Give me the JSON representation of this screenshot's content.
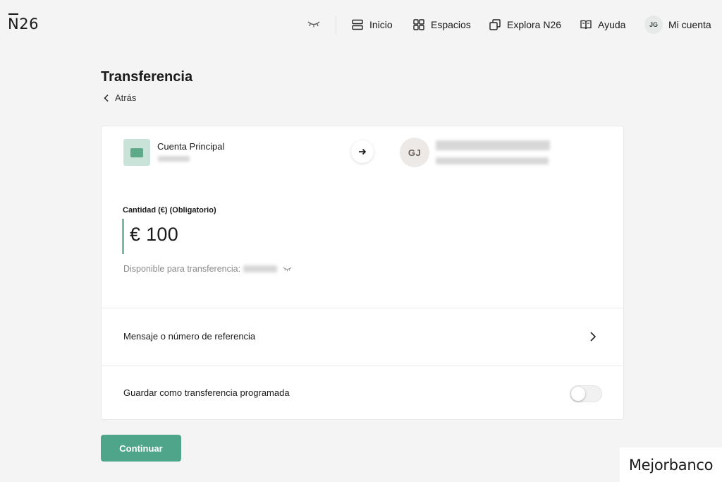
{
  "nav": {
    "logo_n": "N",
    "logo_rest": "26",
    "items": [
      {
        "label": "Inicio",
        "icon": "home-icon"
      },
      {
        "label": "Espacios",
        "icon": "grid-icon"
      },
      {
        "label": "Explora N26",
        "icon": "cards-icon"
      },
      {
        "label": "Ayuda",
        "icon": "book-icon"
      },
      {
        "label": "Mi cuenta",
        "icon": "avatar",
        "initials": "JG"
      }
    ]
  },
  "page": {
    "title": "Transferencia",
    "back_label": "Atrás"
  },
  "transfer": {
    "from_account": "Cuenta Principal",
    "recipient_initials": "GJ",
    "amount_label": "Cantidad (€) (Obligatorio)",
    "amount_value": "€ 100",
    "available_label": "Disponible para transferencia:",
    "reference_label": "Mensaje o número de referencia",
    "schedule_label": "Guardar como transferencia programada",
    "schedule_enabled": false
  },
  "actions": {
    "continue_label": "Continuar"
  },
  "watermark": "Mejorbanco",
  "colors": {
    "accent": "#4ea58a",
    "background": "#f4f4f4"
  }
}
